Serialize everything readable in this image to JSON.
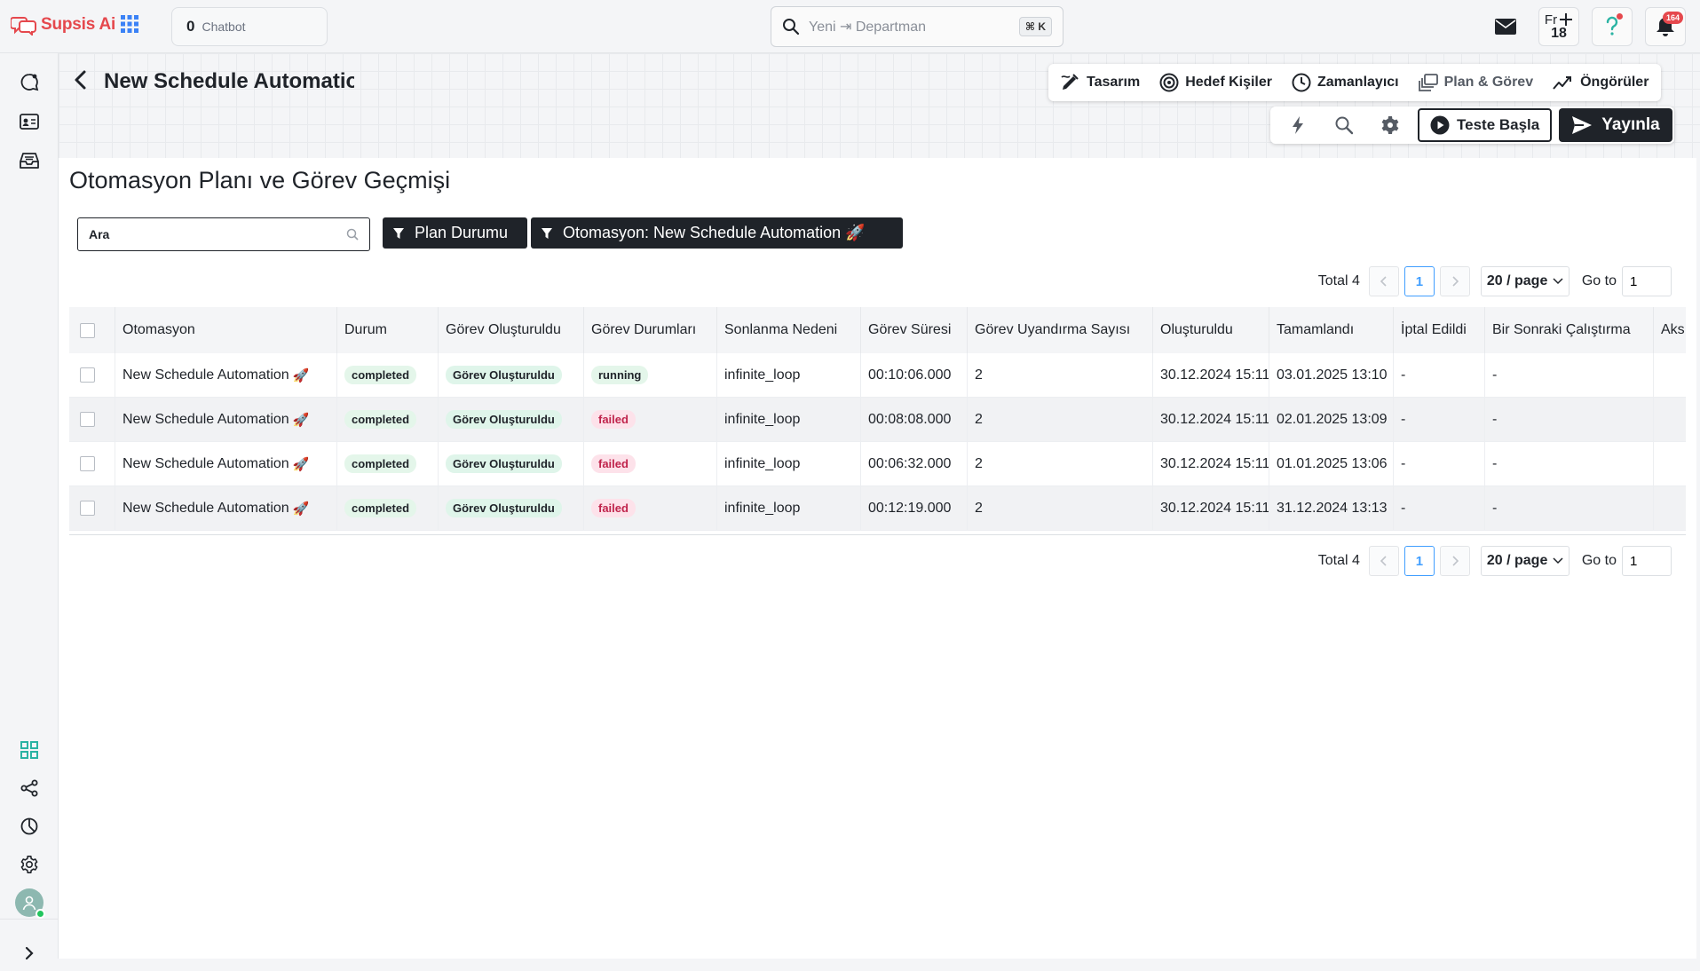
{
  "brand": {
    "name": "Supsis Ai"
  },
  "topbar": {
    "chatbot_count": "0",
    "chatbot_label": "Chatbot",
    "search_placeholder": "Yeni ⇥ Departman",
    "search_shortcut": "⌘ K",
    "fr_label": "Fr",
    "fr_count": "18",
    "notification_count": "164"
  },
  "header": {
    "automation_title": "New Schedule Automation",
    "tabs": [
      {
        "label": "Tasarım",
        "icon": "design-icon"
      },
      {
        "label": "Hedef Kişiler",
        "icon": "target-icon"
      },
      {
        "label": "Zamanlayıcı",
        "icon": "clock-icon"
      },
      {
        "label": "Plan & Görev",
        "icon": "layers-icon"
      },
      {
        "label": "Öngörüler",
        "icon": "trend-icon"
      }
    ],
    "test_label": "Teste Başla",
    "publish_label": "Yayınla"
  },
  "main": {
    "title": "Otomasyon Planı ve Görev Geçmişi",
    "search_placeholder": "Ara",
    "filters": {
      "plan_status": "Plan Durumu",
      "automation": "Otomasyon: New Schedule Automation 🚀"
    }
  },
  "pagination": {
    "total_label": "Total 4",
    "current_page": "1",
    "page_size": "20 / page",
    "goto_label": "Go to",
    "goto_value": "1"
  },
  "table": {
    "columns": [
      "Otomasyon",
      "Durum",
      "Görev Oluşturuldu",
      "Görev Durumları",
      "Sonlanma Nedeni",
      "Görev Süresi",
      "Görev Uyandırma Sayısı",
      "Oluşturuldu",
      "Tamamlandı",
      "İptal Edildi",
      "Bir Sonraki Çalıştırma",
      "Aks"
    ],
    "rows": [
      {
        "automation": "New Schedule Automation",
        "rocket": "🚀",
        "status": "completed",
        "task_created": "Görev Oluşturuldu",
        "task_status": "running",
        "end_reason": "infinite_loop",
        "duration": "00:10:06.000",
        "wake_count": "2",
        "created": "30.12.2024 15:11",
        "completed": "03.01.2025 13:10",
        "cancelled": "-",
        "next_run": "-"
      },
      {
        "automation": "New Schedule Automation",
        "rocket": "🚀",
        "status": "completed",
        "task_created": "Görev Oluşturuldu",
        "task_status": "failed",
        "end_reason": "infinite_loop",
        "duration": "00:08:08.000",
        "wake_count": "2",
        "created": "30.12.2024 15:11",
        "completed": "02.01.2025 13:09",
        "cancelled": "-",
        "next_run": "-"
      },
      {
        "automation": "New Schedule Automation",
        "rocket": "🚀",
        "status": "completed",
        "task_created": "Görev Oluşturuldu",
        "task_status": "failed",
        "end_reason": "infinite_loop",
        "duration": "00:06:32.000",
        "wake_count": "2",
        "created": "30.12.2024 15:11",
        "completed": "01.01.2025 13:06",
        "cancelled": "-",
        "next_run": "-"
      },
      {
        "automation": "New Schedule Automation",
        "rocket": "🚀",
        "status": "completed",
        "task_created": "Görev Oluşturuldu",
        "task_status": "failed",
        "end_reason": "infinite_loop",
        "duration": "00:12:19.000",
        "wake_count": "2",
        "created": "30.12.2024 15:11",
        "completed": "31.12.2024 13:13",
        "cancelled": "-",
        "next_run": "-"
      }
    ]
  },
  "colors": {
    "brand_red": "#e5484d",
    "dark": "#1f2329",
    "pager_active": "#409eff",
    "badge_green_bg": "#e4f6ea",
    "badge_failed_bg": "#fde2ea",
    "badge_failed_text": "#c0244c"
  }
}
